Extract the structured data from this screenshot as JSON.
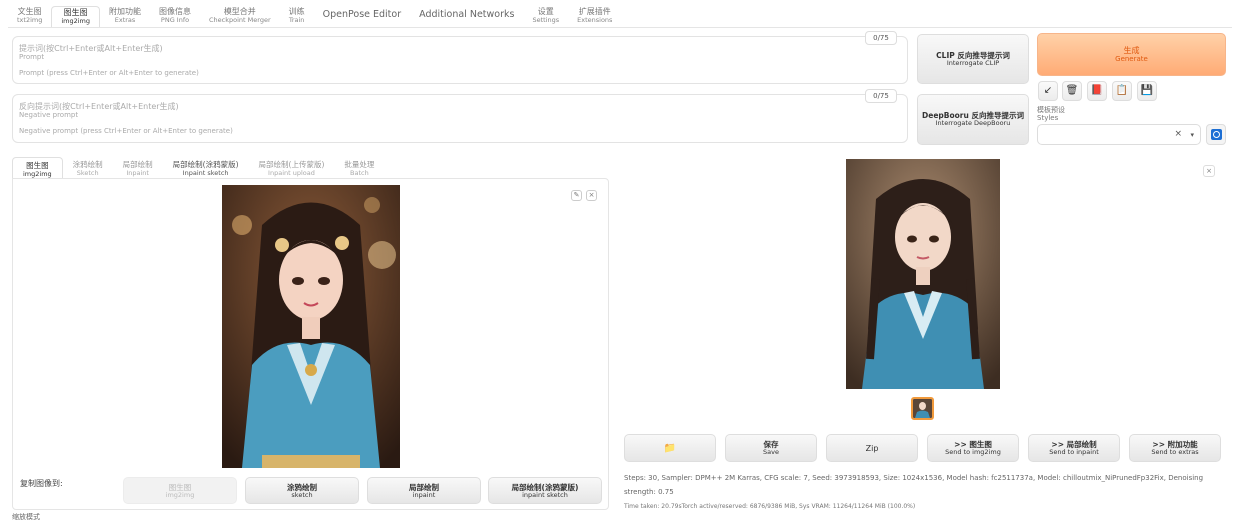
{
  "top_tabs": [
    {
      "zh": "文生图",
      "en": "txt2img"
    },
    {
      "zh": "图生图",
      "en": "img2img"
    },
    {
      "zh": "附加功能",
      "en": "Extras"
    },
    {
      "zh": "图像信息",
      "en": "PNG Info"
    },
    {
      "zh": "模型合并",
      "en": "Checkpoint Merger"
    },
    {
      "zh": "训练",
      "en": "Train"
    },
    {
      "zh": "OpenPose Editor",
      "en": ""
    },
    {
      "zh": "Additional Networks",
      "en": ""
    },
    {
      "zh": "设置",
      "en": "Settings"
    },
    {
      "zh": "扩展插件",
      "en": "Extensions"
    }
  ],
  "prompt": {
    "placeholder_zh": "提示词(按Ctrl+Enter或Alt+Enter生成)",
    "label": "Prompt",
    "placeholder_en": "Prompt (press Ctrl+Enter or Alt+Enter to generate)",
    "counter": "0/75"
  },
  "negative_prompt": {
    "placeholder_zh": "反向提示词(按Ctrl+Enter或Alt+Enter生成)",
    "label": "Negative prompt",
    "placeholder_en": "Negative prompt (press Ctrl+Enter or Alt+Enter to generate)",
    "counter": "0/75"
  },
  "interrogate_clip": {
    "zh": "CLIP 反向推导提示词",
    "en": "Interrogate CLIP"
  },
  "interrogate_deepbooru": {
    "zh": "DeepBooru 反向推导提示词",
    "en": "Interrogate DeepBooru"
  },
  "generate": {
    "zh": "生成",
    "en": "Generate"
  },
  "tool_icons": [
    "↙",
    "🗑",
    "📕",
    "📋",
    "💾"
  ],
  "styles": {
    "label_zh": "模板预设",
    "label_en": "Styles",
    "clear": "×",
    "dropdown": "▾"
  },
  "sub_tabs": [
    {
      "zh": "图生图",
      "en": "img2img"
    },
    {
      "zh": "涂鸦绘制",
      "en": "Sketch"
    },
    {
      "zh": "局部绘制",
      "en": "Inpaint"
    },
    {
      "zh": "局部绘制(涂鸦蒙版)",
      "en": "Inpaint sketch"
    },
    {
      "zh": "局部绘制(上传蒙版)",
      "en": "Inpaint upload"
    },
    {
      "zh": "批量处理",
      "en": "Batch"
    }
  ],
  "image_controls": {
    "edit": "✎",
    "close": "×"
  },
  "copy_image_to": {
    "label": "复制图像到:",
    "buttons": [
      {
        "zh": "图生图",
        "en": "img2img"
      },
      {
        "zh": "涂鸦绘制",
        "en": "sketch"
      },
      {
        "zh": "局部绘制",
        "en": "inpaint"
      },
      {
        "zh": "局部绘制(涂鸦蒙版)",
        "en": "inpaint sketch"
      }
    ]
  },
  "resize_mode_label": "缩放模式",
  "output": {
    "close": "×",
    "actions": [
      {
        "zh": "📁",
        "en": ""
      },
      {
        "zh": "保存",
        "en": "Save"
      },
      {
        "zh": "Zip",
        "en": ""
      },
      {
        "zh": ">> 图生图",
        "en": "Send to img2img"
      },
      {
        "zh": ">> 局部绘制",
        "en": "Send to inpaint"
      },
      {
        "zh": ">> 附加功能",
        "en": "Send to extras"
      }
    ],
    "info": "Steps: 30, Sampler: DPM++ 2M Karras, CFG scale: 7, Seed: 3973918593, Size: 1024x1536, Model hash: fc2511737a, Model: chilloutmix_NiPrunedFp32Fix, Denoising strength: 0.75",
    "time": "Time taken: 20.79sTorch active/reserved: 6876/9386 MiB, Sys VRAM: 11264/11264 MiB (100.0%)"
  },
  "colors": {
    "accent": "#ff8c42",
    "generate_text": "#e05a10",
    "blue": "#1d6fd4"
  }
}
